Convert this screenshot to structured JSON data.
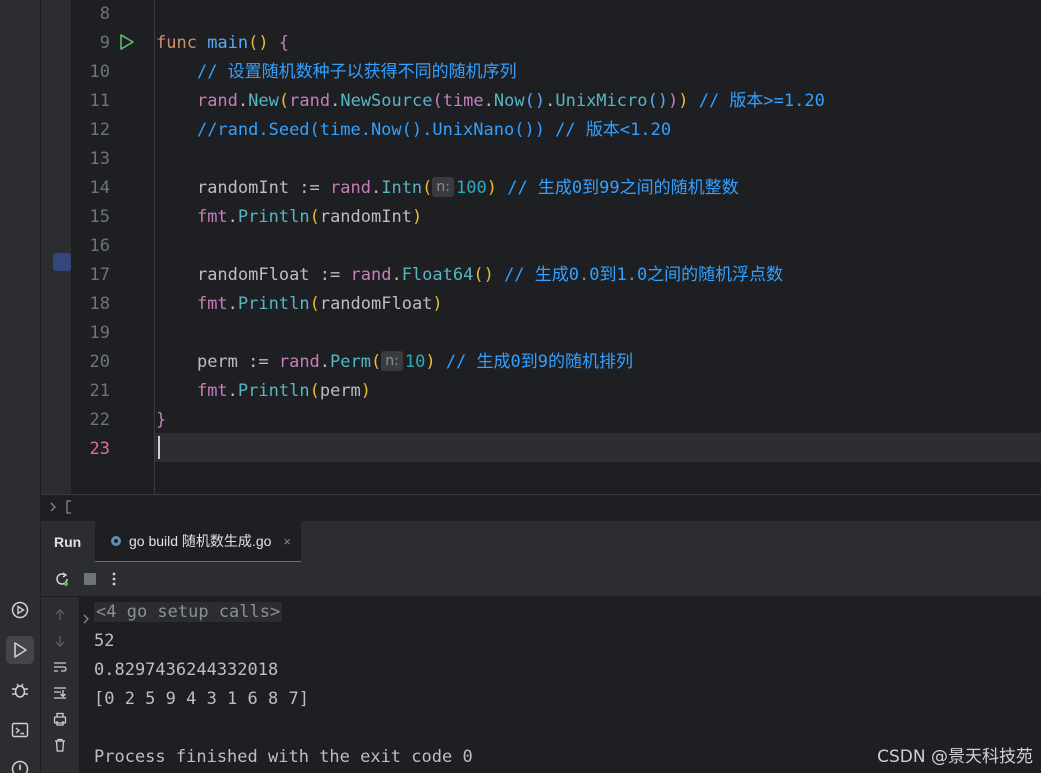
{
  "editor": {
    "lines": [
      {
        "num": "8",
        "segments": []
      },
      {
        "num": "9",
        "segments": [
          {
            "t": "func ",
            "c": "kw"
          },
          {
            "t": "main",
            "c": "fn"
          },
          {
            "t": "()",
            "c": "par-y"
          },
          {
            "t": " {",
            "c": "par-p"
          }
        ]
      },
      {
        "num": "10",
        "segments": [
          {
            "t": "    "
          },
          {
            "t": "// 设置随机数种子以获得不同的随机序列",
            "c": "cmt"
          }
        ]
      },
      {
        "num": "11",
        "segments": [
          {
            "t": "    "
          },
          {
            "t": "rand",
            "c": "pkg"
          },
          {
            "t": ".",
            "c": "id"
          },
          {
            "t": "New",
            "c": "meth"
          },
          {
            "t": "(",
            "c": "par-y"
          },
          {
            "t": "rand",
            "c": "pkg"
          },
          {
            "t": ".",
            "c": "id"
          },
          {
            "t": "NewSource",
            "c": "meth"
          },
          {
            "t": "(",
            "c": "par-p"
          },
          {
            "t": "time",
            "c": "pkg"
          },
          {
            "t": ".",
            "c": "id"
          },
          {
            "t": "Now",
            "c": "meth"
          },
          {
            "t": "()",
            "c": "par-b"
          },
          {
            "t": ".",
            "c": "id"
          },
          {
            "t": "UnixMicro",
            "c": "meth"
          },
          {
            "t": "()",
            "c": "par-b"
          },
          {
            "t": ")",
            "c": "par-p"
          },
          {
            "t": ")",
            "c": "par-y"
          },
          {
            "t": " // 版本>=1.20",
            "c": "cmt"
          }
        ]
      },
      {
        "num": "12",
        "segments": [
          {
            "t": "    "
          },
          {
            "t": "//rand.Seed(time.Now().UnixNano()) // 版本<1.20",
            "c": "cmt"
          }
        ]
      },
      {
        "num": "13",
        "segments": []
      },
      {
        "num": "14",
        "segments": [
          {
            "t": "    "
          },
          {
            "t": "randomInt := ",
            "c": "id"
          },
          {
            "t": "rand",
            "c": "pkg"
          },
          {
            "t": ".",
            "c": "id"
          },
          {
            "t": "Intn",
            "c": "meth"
          },
          {
            "t": "(",
            "c": "par-y"
          },
          {
            "hint": "n:"
          },
          {
            "t": "100",
            "c": "num"
          },
          {
            "t": ")",
            "c": "par-y"
          },
          {
            "t": " // 生成0到99之间的随机整数",
            "c": "cmt"
          }
        ]
      },
      {
        "num": "15",
        "segments": [
          {
            "t": "    "
          },
          {
            "t": "fmt",
            "c": "pkg"
          },
          {
            "t": ".",
            "c": "id"
          },
          {
            "t": "Println",
            "c": "meth"
          },
          {
            "t": "(",
            "c": "par-y"
          },
          {
            "t": "randomInt",
            "c": "id"
          },
          {
            "t": ")",
            "c": "par-y"
          }
        ]
      },
      {
        "num": "16",
        "segments": []
      },
      {
        "num": "17",
        "segments": [
          {
            "t": "    "
          },
          {
            "t": "randomFloat := ",
            "c": "id"
          },
          {
            "t": "rand",
            "c": "pkg"
          },
          {
            "t": ".",
            "c": "id"
          },
          {
            "t": "Float64",
            "c": "meth"
          },
          {
            "t": "()",
            "c": "par-y"
          },
          {
            "t": " // 生成0.0到1.0之间的随机浮点数",
            "c": "cmt"
          }
        ]
      },
      {
        "num": "18",
        "segments": [
          {
            "t": "    "
          },
          {
            "t": "fmt",
            "c": "pkg"
          },
          {
            "t": ".",
            "c": "id"
          },
          {
            "t": "Println",
            "c": "meth"
          },
          {
            "t": "(",
            "c": "par-y"
          },
          {
            "t": "randomFloat",
            "c": "id"
          },
          {
            "t": ")",
            "c": "par-y"
          }
        ]
      },
      {
        "num": "19",
        "segments": []
      },
      {
        "num": "20",
        "segments": [
          {
            "t": "    "
          },
          {
            "t": "perm := ",
            "c": "id"
          },
          {
            "t": "rand",
            "c": "pkg"
          },
          {
            "t": ".",
            "c": "id"
          },
          {
            "t": "Perm",
            "c": "meth"
          },
          {
            "t": "(",
            "c": "par-y"
          },
          {
            "hint": "n:"
          },
          {
            "t": "10",
            "c": "num"
          },
          {
            "t": ")",
            "c": "par-y"
          },
          {
            "t": " // 生成0到9的随机排列",
            "c": "cmt"
          }
        ]
      },
      {
        "num": "21",
        "segments": [
          {
            "t": "    "
          },
          {
            "t": "fmt",
            "c": "pkg"
          },
          {
            "t": ".",
            "c": "id"
          },
          {
            "t": "Println",
            "c": "meth"
          },
          {
            "t": "(",
            "c": "par-y"
          },
          {
            "t": "perm",
            "c": "id"
          },
          {
            "t": ")",
            "c": "par-y"
          }
        ]
      },
      {
        "num": "22",
        "segments": [
          {
            "t": "}",
            "c": "par-p"
          }
        ]
      },
      {
        "num": "23",
        "segments": [],
        "current": true
      }
    ]
  },
  "run_panel": {
    "title": "Run",
    "tab_label": "go build 随机数生成.go",
    "tab_close": "×",
    "console_lines": [
      {
        "text": "<4 go setup calls>",
        "fold": true
      },
      {
        "text": "52"
      },
      {
        "text": "0.8297436244332018"
      },
      {
        "text": "[0 2 5 9 4 3 1 6 8 7]"
      },
      {
        "text": ""
      },
      {
        "text": "Process finished with the exit code 0"
      }
    ]
  },
  "watermark": "CSDN @景天科技苑",
  "colors": {
    "keyword": "#cf8e6d",
    "function": "#56a8f5",
    "package": "#c77dbb",
    "method": "#56b6c2",
    "number": "#2aacb8",
    "comment": "#33a0ff",
    "current_line_number": "#e06c9f",
    "accent": "#3574f0"
  }
}
